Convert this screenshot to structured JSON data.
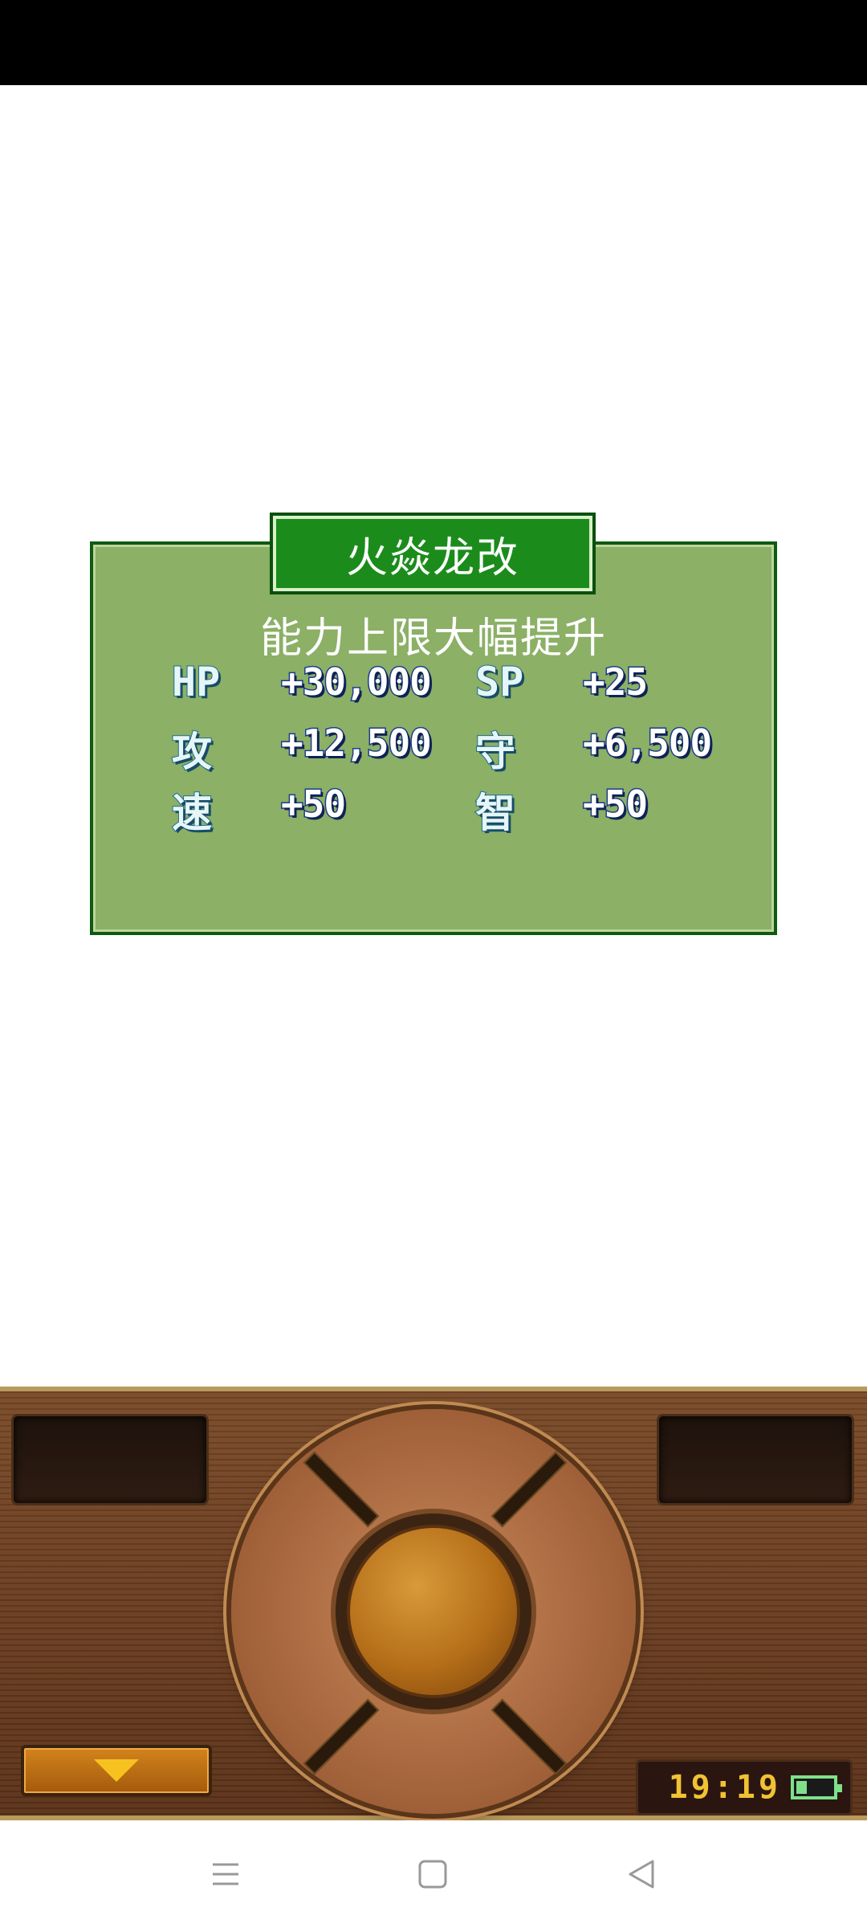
{
  "dialog": {
    "title": "火焱龙改",
    "subtitle": "能力上限大幅提升",
    "stats": [
      {
        "label": "HP",
        "value": "+30,000"
      },
      {
        "label": "SP",
        "value": "+25"
      },
      {
        "label": "攻",
        "value": "+12,500"
      },
      {
        "label": "守",
        "value": "+6,500"
      },
      {
        "label": "速",
        "value": "+50"
      },
      {
        "label": "智",
        "value": "+50"
      }
    ],
    "colors": {
      "panel": "#8bb066",
      "title_bg": "#1b8c1c",
      "label_outline": "#1e6d90",
      "value_outline": "#1d3c8a"
    }
  },
  "controller": {
    "clock": "19:19",
    "battery_level": 0.3,
    "menu_toggle_icon": "down-arrow-icon"
  },
  "nav_bar": {
    "icons": [
      "menu-icon",
      "home-icon",
      "back-icon"
    ]
  }
}
